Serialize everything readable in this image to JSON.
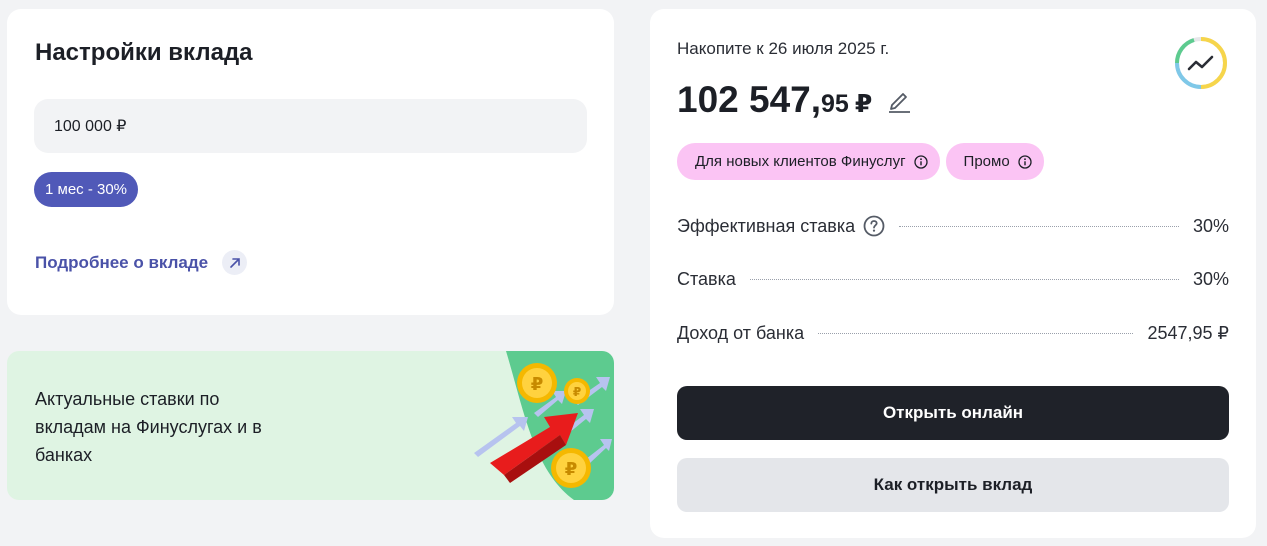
{
  "settings": {
    "title": "Настройки вклада",
    "amount_value": "100 000 ₽",
    "term_chip": "1 мес - 30%",
    "more_link": "Подробнее о вкладе"
  },
  "promo": {
    "text": "Актуальные ставки по вкладам на Финуслугах и в банках"
  },
  "result": {
    "goal_label": "Накопите к 26 июля 2025 г.",
    "goal_int": "102 547,",
    "goal_frac": "95",
    "goal_currency": "₽",
    "tags": [
      {
        "label": "Для новых клиентов Финуслуг"
      },
      {
        "label": "Промо"
      }
    ],
    "rows": {
      "effective_label": "Эффективная ставка",
      "effective_value": "30%",
      "rate_label": "Ставка",
      "rate_value": "30%",
      "income_label": "Доход от банка",
      "income_value": "2547,95 ₽"
    },
    "open_online": "Открыть онлайн",
    "how_to_open": "Как открыть вклад"
  },
  "colors": {
    "chip": "#5059b8",
    "tag": "#fbc4f4",
    "primary_button": "#1f2229",
    "promo_bg": "#dff4e3",
    "link": "#4a52a8"
  },
  "icons": [
    "arrow-up-right-icon",
    "edit-pencil-icon",
    "chart-ring-icon",
    "info-icon",
    "help-question-icon",
    "ruble-coins-arrows-illustration"
  ]
}
